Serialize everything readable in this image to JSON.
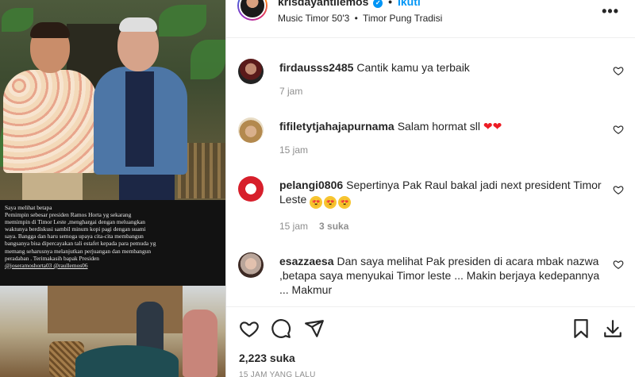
{
  "header": {
    "username": "krisdayantilemos",
    "follow_label": "Ikuti",
    "dot": "•",
    "audio": "Music Timor 50'3",
    "location": "Timor Pung Tradisi",
    "more": "•••"
  },
  "post": {
    "caption": "Saya melihat betapa\nPemimpin sebesar presiden Ramos Horta yg sekarang\nmemimpin di Timor Leste ,menghargai dengan meluangkan\nwaktunya berdiskusi sambil minum kopi pagi dengan suami\nsaya. Bangga dan haru semoga upaya cita-cita membangun\nbangsanya bisa dipercayakan tali estafet kepada para pemuda yg\nmemang seharusnya melanjutkan perjuangan dan membangun\nperadaban . Terimakasih bapak Presiden",
    "caption_tags": "@joseramoshorta03 @raullemos06"
  },
  "comments": [
    {
      "username": "firdausss2485",
      "text": "Cantik kamu ya terbaik",
      "time": "7 jam",
      "likes": ""
    },
    {
      "username": "fifiletytjahajapurnama",
      "text": "Salam hormat sll",
      "emoji": [
        "❤",
        "❤"
      ],
      "time": "15 jam",
      "likes": ""
    },
    {
      "username": "pelangi0806",
      "text": "Sepertinya Pak Raul bakal jadi next president Timor Leste",
      "emoji": [
        "😍",
        "😍",
        "😍"
      ],
      "time": "15 jam",
      "likes": "3 suka"
    },
    {
      "username": "esazzaesa",
      "text": "Dan saya melihat Pak presiden di acara mbak nazwa ,betapa saya menyukai Timor leste ... Makin berjaya kedepannya ... Makmur",
      "time": "",
      "likes": ""
    }
  ],
  "footer": {
    "likes": "2,223 suka",
    "timestamp": "15 JAM YANG LALU"
  },
  "colors": {
    "accent": "#0095f6",
    "text": "#262626",
    "muted": "#8e8e8e",
    "heart_red": "#ed1c24"
  },
  "icons": [
    "verified-icon",
    "more-icon",
    "heart-outline-icon",
    "comment-icon",
    "share-icon",
    "bookmark-icon",
    "download-icon"
  ]
}
